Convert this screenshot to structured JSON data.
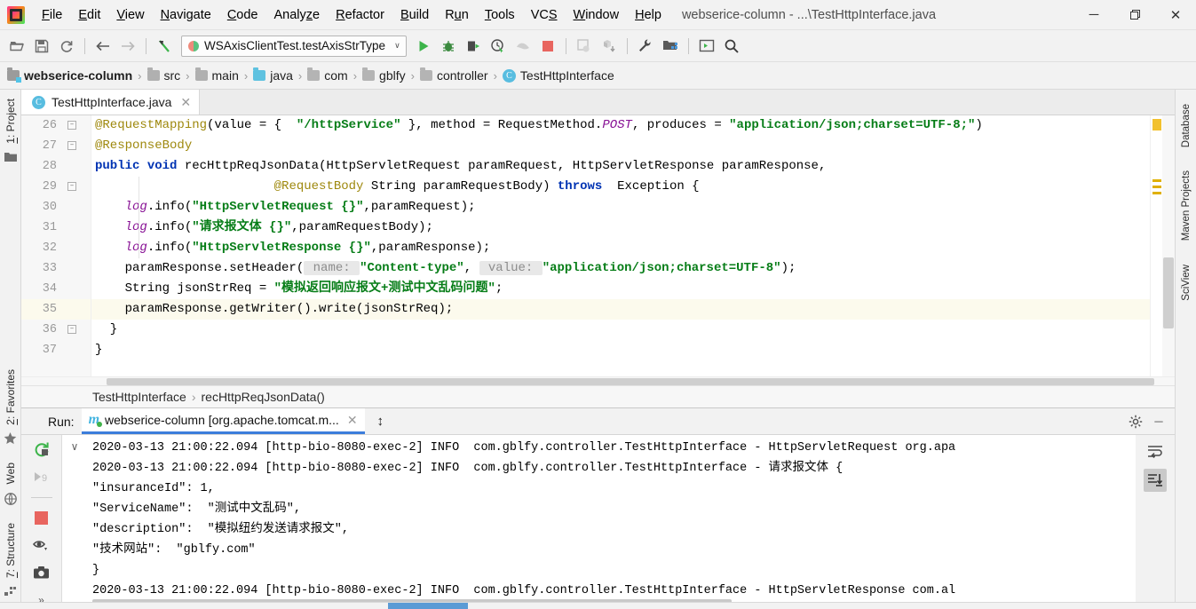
{
  "titlebar": {
    "logo_icon": "intellij-idea-logo",
    "menus": [
      "File",
      "Edit",
      "View",
      "Navigate",
      "Code",
      "Analyze",
      "Refactor",
      "Build",
      "Run",
      "Tools",
      "VCS",
      "Window",
      "Help"
    ],
    "window_title": "webserice-column - ...\\TestHttpInterface.java",
    "minimize": "─",
    "maximize": "❐",
    "close": "✕"
  },
  "toolbar": {
    "open_icon": "open-folder-icon",
    "save_icon": "save-icon",
    "sync_icon": "sync-refresh-icon",
    "back_icon": "←",
    "forward_icon": "→",
    "jump_icon": "jump-to-source-icon",
    "run_config": "WSAxisClientTest.testAxisStrType",
    "run_config_chevron": "∨",
    "run_icon": "run-icon",
    "debug_icon": "debug-icon",
    "run_coverage_icon": "run-with-coverage-icon",
    "profile_icon": "profiler-icon",
    "attach_icon": "attach-debugger-icon",
    "stop_icon": "stop-icon",
    "update_app_icon": "update-application-icon",
    "fetch_icon": "import-module-icon",
    "settings_icon": "settings-wrench-icon",
    "project_structure_icon": "project-structure-icon",
    "terminal_icon": "terminal-icon",
    "search_icon": "search-everywhere-icon"
  },
  "breadcrumbs": [
    {
      "label": "webserice-column",
      "icon": "project-module-icon",
      "bold": true
    },
    {
      "label": "src",
      "icon": "folder-icon",
      "bold": false
    },
    {
      "label": "main",
      "icon": "folder-icon",
      "bold": false
    },
    {
      "label": "java",
      "icon": "source-root-folder-icon",
      "bold": false
    },
    {
      "label": "com",
      "icon": "package-icon",
      "bold": false
    },
    {
      "label": "gblfy",
      "icon": "package-icon",
      "bold": false
    },
    {
      "label": "controller",
      "icon": "package-icon",
      "bold": false
    },
    {
      "label": "TestHttpInterface",
      "icon": "java-class-icon",
      "bold": false
    }
  ],
  "left_strip": {
    "project_label": "1: Project",
    "project_icon": "project-folder-icon",
    "favorites_label": "2: Favorites",
    "favorites_icon": "star-icon",
    "web_label": "Web",
    "web_icon": "globe-icon",
    "structure_label": "7: Structure",
    "structure_icon": "structure-icon"
  },
  "editor": {
    "tab_label": "TestHttpInterface.java",
    "tab_icon": "java-class-icon",
    "tab_close_icon": "✕",
    "first_line_number": 26,
    "highlight_line": 35,
    "lines": [
      {
        "n": 26,
        "fold": "minus"
      },
      {
        "n": 27,
        "fold": "minus"
      },
      {
        "n": 28,
        "fold": ""
      },
      {
        "n": 29,
        "fold": "minus"
      },
      {
        "n": 30,
        "fold": ""
      },
      {
        "n": 31,
        "fold": ""
      },
      {
        "n": 32,
        "fold": ""
      },
      {
        "n": 33,
        "fold": ""
      },
      {
        "n": 34,
        "fold": ""
      },
      {
        "n": 35,
        "fold": ""
      },
      {
        "n": 36,
        "fold": "minus"
      },
      {
        "n": 37,
        "fold": ""
      }
    ],
    "code": [
      "@RequestMapping(value = {  \"/httpService\" }, method = RequestMethod.POST, produces = \"application/json;charset=UTF-8;\")",
      "@ResponseBody",
      "public void recHttpReqJsonData(HttpServletRequest paramRequest, HttpServletResponse paramResponse,",
      "                @RequestBody String paramRequestBody) throws  Exception {",
      "log.info(\"HttpServletRequest {}\",paramRequest);",
      "log.info(\"请求报文体 {}\",paramRequestBody);",
      "log.info(\"HttpServletResponse {}\",paramResponse);",
      "paramResponse.setHeader( name: \"Content-type\",  value: \"application/json;charset=UTF-8\");",
      "String jsonStrReq = \"模拟返回响应报文+测试中文乱码问题\";",
      "paramResponse.getWriter().write(jsonStrReq);",
      "}",
      "}"
    ],
    "breadcrumb_class": "TestHttpInterface",
    "breadcrumb_sep": "›",
    "breadcrumb_method": "recHttpReqJsonData()"
  },
  "run_window": {
    "label": "Run:",
    "tab_title": "webserice-column [org.apache.tomcat.m...",
    "tab_icon": "maven-m-icon",
    "tab_close_icon": "✕",
    "resize_icon": "↕",
    "settings_icon": "gear-icon",
    "minimize_icon": "─",
    "collapse_icon": "∨",
    "actions": {
      "rerun_icon": "rerun-icon",
      "resume_icon": "resume-program-icon",
      "stop_icon": "stop-red-square-icon",
      "filter_icon": "print-filter-eye-icon",
      "screenshot_icon": "camera-icon",
      "more_icon": "»"
    },
    "right_actions": {
      "soft_wrap_icon": "soft-wrap-icon",
      "scroll_to_end_icon": "scroll-to-end-icon"
    },
    "console": [
      "2020-03-13 21:00:22.094 [http-bio-8080-exec-2] INFO  com.gblfy.controller.TestHttpInterface - HttpServletRequest org.apa",
      "2020-03-13 21:00:22.094 [http-bio-8080-exec-2] INFO  com.gblfy.controller.TestHttpInterface - 请求报文体 {",
      "\"insuranceId\": 1,",
      "\"ServiceName\":  \"测试中文乱码\",",
      "\"description\":  \"模拟纽约发送请求报文\",",
      "\"技术网站\":  \"gblfy.com\"",
      "}",
      "2020-03-13 21:00:22.094 [http-bio-8080-exec-2] INFO  com.gblfy.controller.TestHttpInterface - HttpServletResponse com.al"
    ]
  },
  "right_strip": {
    "items": [
      "Database",
      "Maven Projects",
      "SciView"
    ]
  },
  "colors": {
    "accent_blue": "#3c7ddb",
    "keyword": "#0033b3",
    "string": "#067d17",
    "annotation": "#9e880d",
    "field": "#871094",
    "highlight_line": "#fcfaed"
  }
}
